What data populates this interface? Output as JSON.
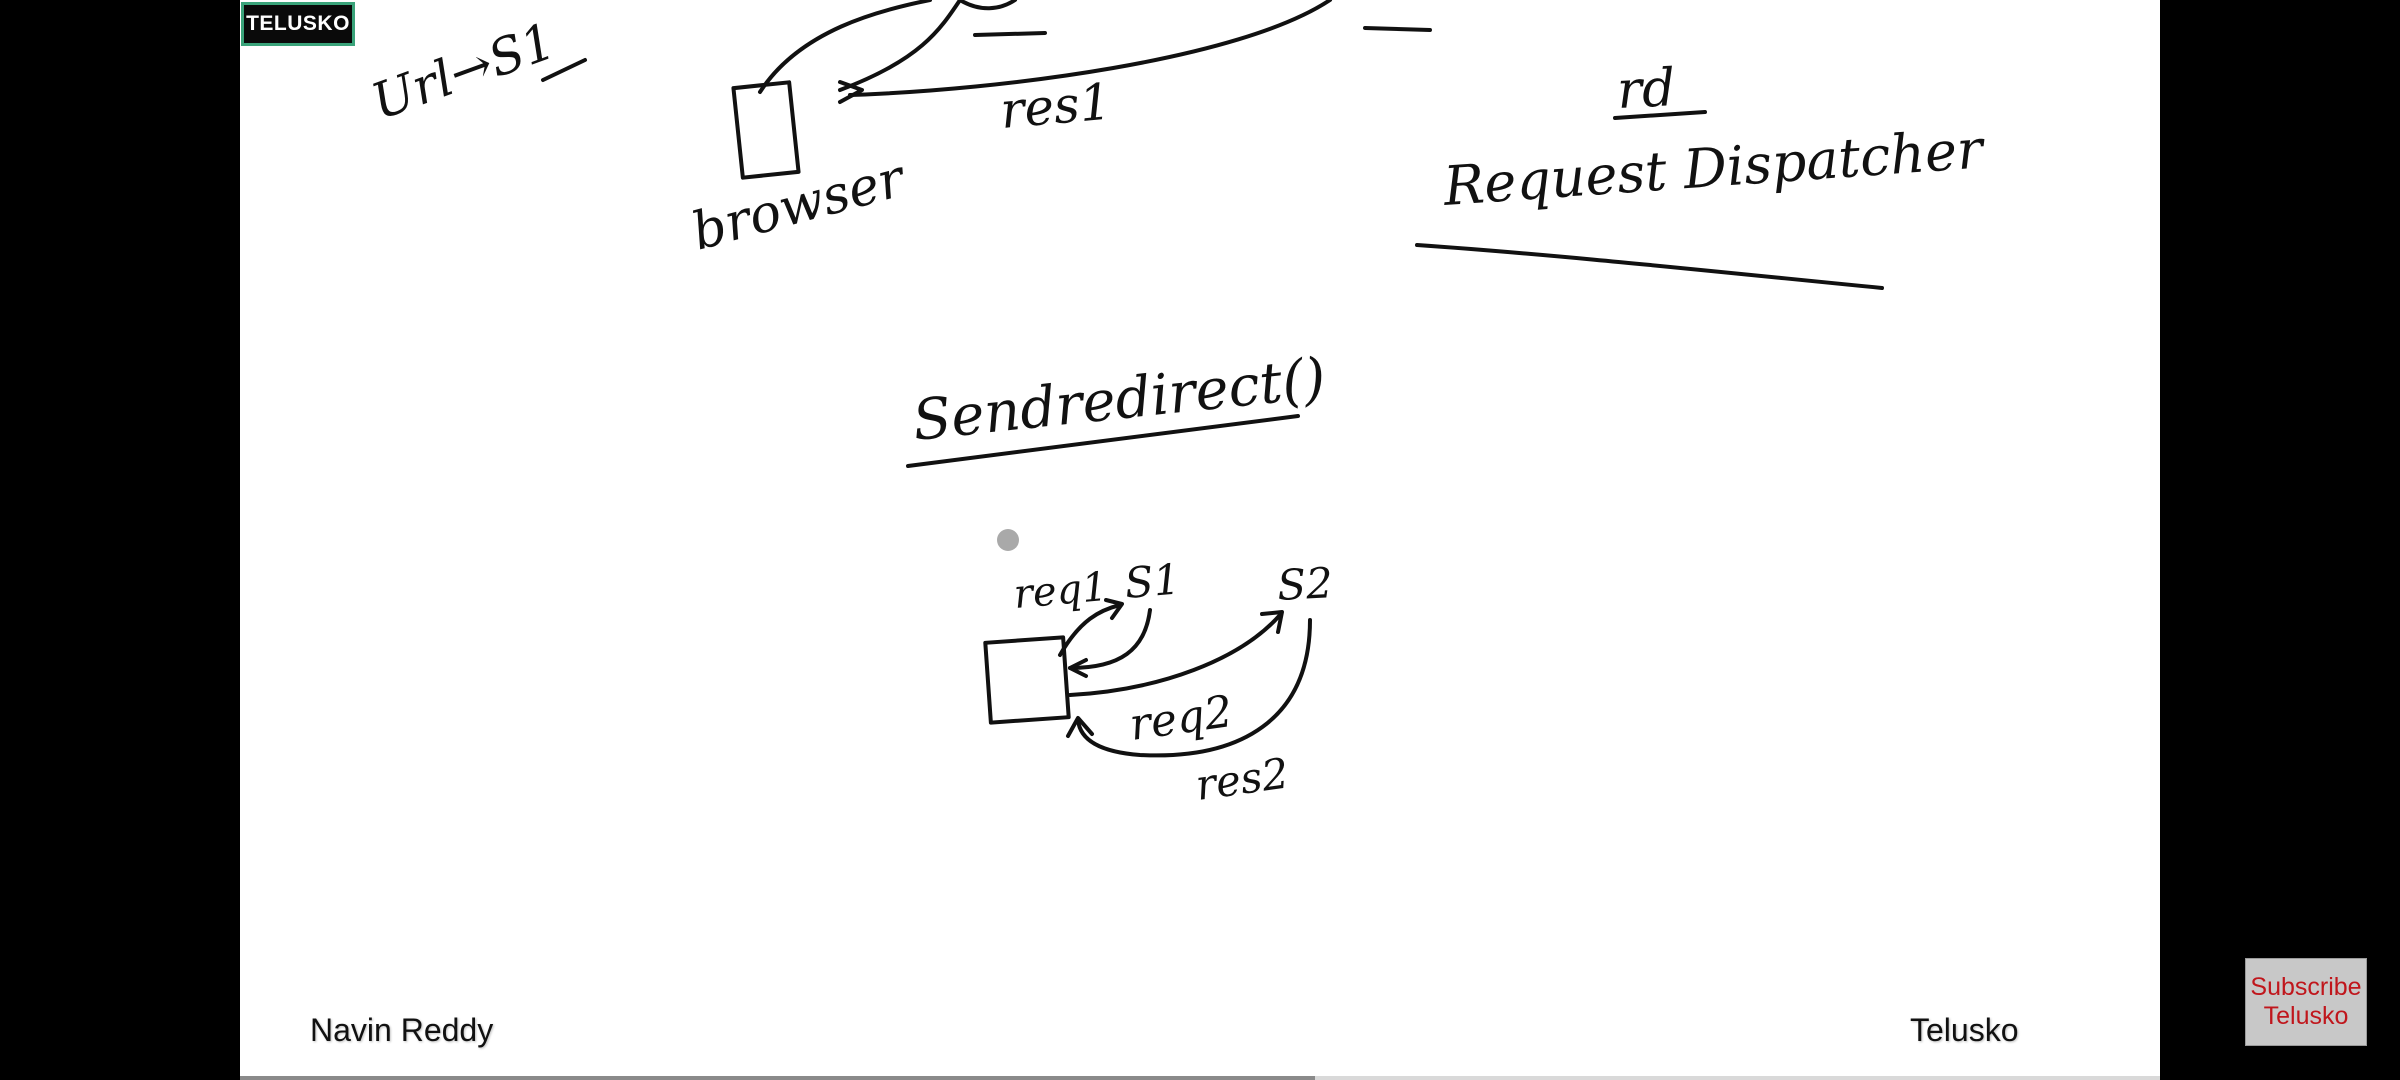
{
  "video": {
    "logo_badge": "TELUSKO",
    "presenter": "Navin Reddy",
    "channel": "Telusko",
    "subscribe": {
      "line1": "Subscribe",
      "line2": "Telusko"
    },
    "progress_fraction": 0.56
  },
  "whiteboard": {
    "annotations": {
      "url_mapping": "Url→S1",
      "browser_label": "browser",
      "res1_label": "res1",
      "rd_label": "rd",
      "request_dispatcher_label": "Request Dispatcher",
      "send_redirect_label": "Sendredirect()",
      "req1_label": "req1",
      "s1_label": "S1",
      "s2_label": "S2",
      "req2_label": "req2",
      "res2_label": "res2"
    }
  },
  "colors": {
    "background": "#000000",
    "board": "#ffffff",
    "ink": "#111111",
    "badge_border": "#3aa37a",
    "subscribe_text": "#c0161c"
  }
}
